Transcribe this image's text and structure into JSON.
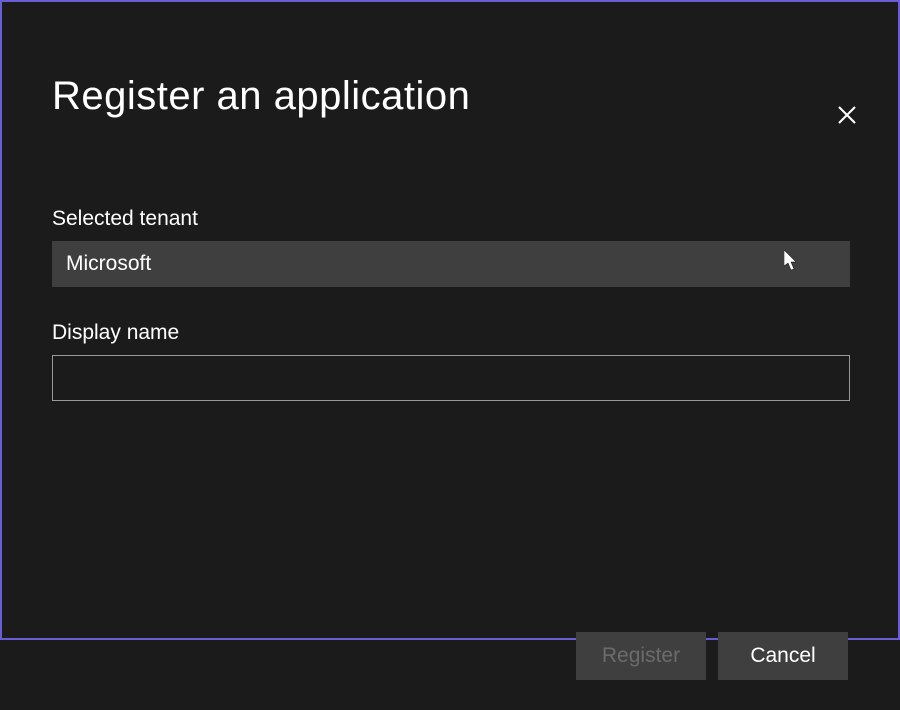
{
  "dialog": {
    "title": "Register an application",
    "fields": {
      "tenant": {
        "label": "Selected tenant",
        "value": "Microsoft"
      },
      "displayName": {
        "label": "Display name",
        "value": ""
      }
    },
    "buttons": {
      "register": "Register",
      "cancel": "Cancel"
    }
  }
}
